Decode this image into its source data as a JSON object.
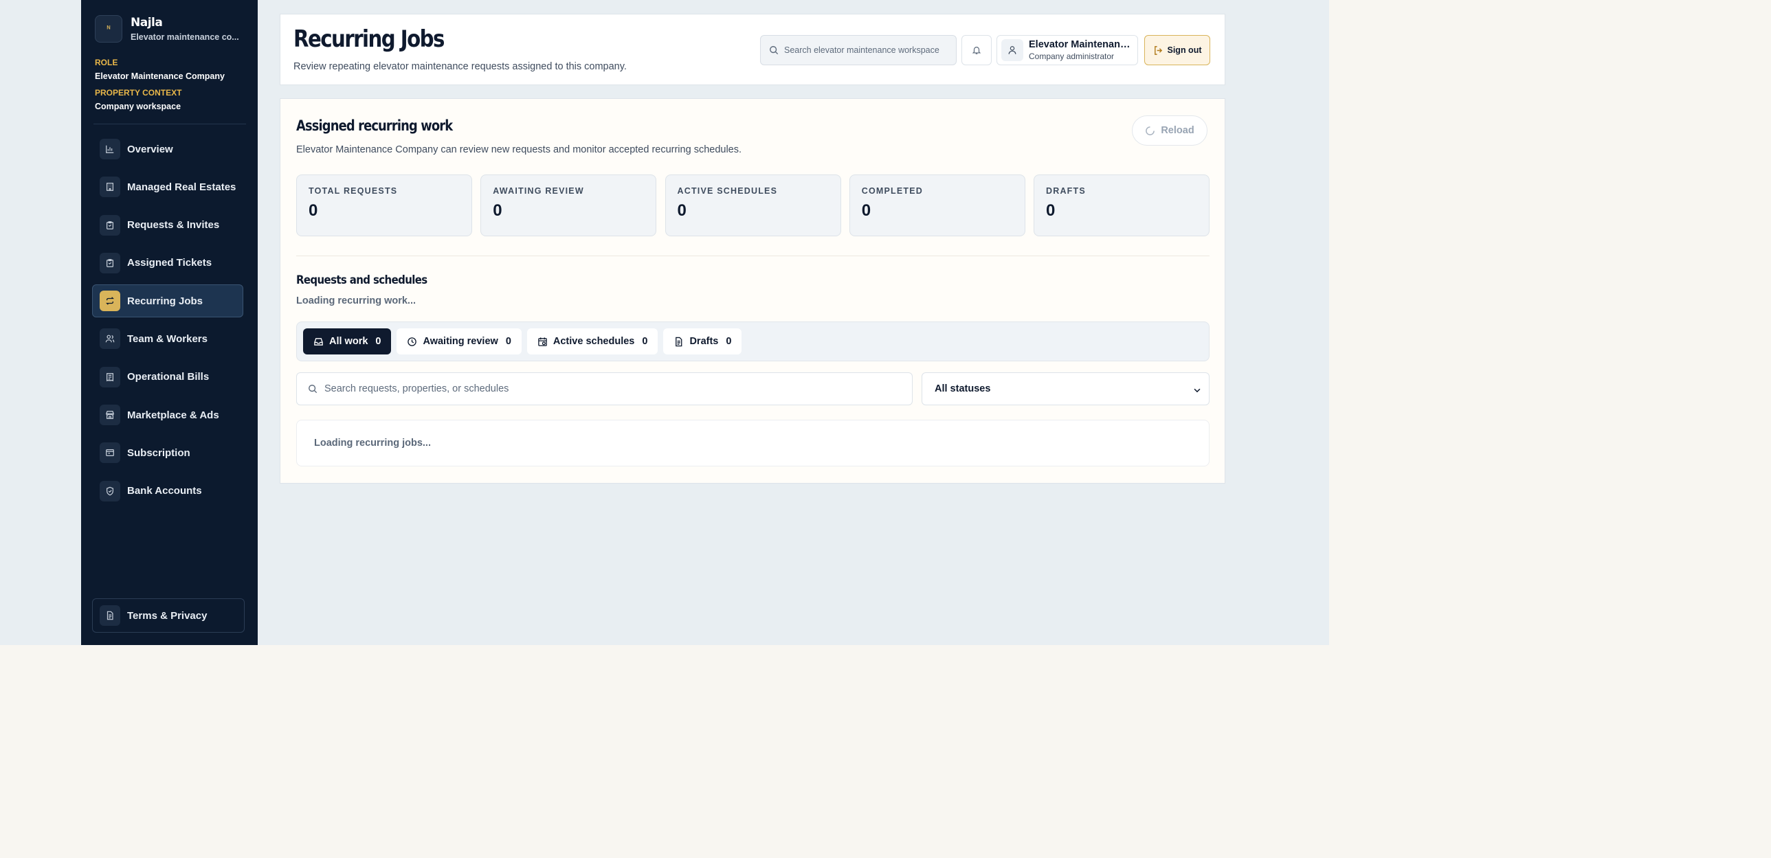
{
  "brand": {
    "name": "Najla",
    "subtitle": "Elevator maintenance co...",
    "logo_text": "ᴺ"
  },
  "context": {
    "role_label": "ROLE",
    "role_value": "Elevator Maintenance Company",
    "property_label": "PROPERTY CONTEXT",
    "property_value": "Company workspace"
  },
  "sidebar": {
    "items": [
      {
        "label": "Overview",
        "icon": "bar-chart-icon"
      },
      {
        "label": "Managed Real Estates",
        "icon": "building-icon"
      },
      {
        "label": "Requests & Invites",
        "icon": "clipboard-icon"
      },
      {
        "label": "Assigned Tickets",
        "icon": "clipboard-check-icon"
      },
      {
        "label": "Recurring Jobs",
        "icon": "repeat-icon",
        "active": true
      },
      {
        "label": "Team & Workers",
        "icon": "users-icon"
      },
      {
        "label": "Operational Bills",
        "icon": "receipt-icon"
      },
      {
        "label": "Marketplace & Ads",
        "icon": "store-icon"
      },
      {
        "label": "Subscription",
        "icon": "card-icon"
      },
      {
        "label": "Bank Accounts",
        "icon": "shield-icon"
      }
    ],
    "terms_label": "Terms & Privacy"
  },
  "header": {
    "title": "Recurring Jobs",
    "subtitle": "Review repeating elevator maintenance requests assigned to this company.",
    "search_placeholder": "Search elevator maintenance workspace",
    "user_name": "Elevator Maintenance Company",
    "user_role": "Company administrator",
    "signout_label": "Sign out"
  },
  "main": {
    "title": "Assigned recurring work",
    "subtitle": "Elevator Maintenance Company can review new requests and monitor accepted recurring schedules.",
    "reload_label": "Reload",
    "stats": [
      {
        "label": "TOTAL REQUESTS",
        "value": "0"
      },
      {
        "label": "AWAITING REVIEW",
        "value": "0"
      },
      {
        "label": "ACTIVE SCHEDULES",
        "value": "0"
      },
      {
        "label": "COMPLETED",
        "value": "0"
      },
      {
        "label": "DRAFTS",
        "value": "0"
      }
    ],
    "list_title": "Requests and schedules",
    "list_status": "Loading recurring work...",
    "tabs": [
      {
        "label": "All work",
        "count": "0",
        "icon": "inbox-icon"
      },
      {
        "label": "Awaiting review",
        "count": "0",
        "icon": "clock-icon"
      },
      {
        "label": "Active schedules",
        "count": "0",
        "icon": "calendar-icon"
      },
      {
        "label": "Drafts",
        "count": "0",
        "icon": "document-icon"
      }
    ],
    "filter_placeholder": "Search requests, properties, or schedules",
    "status_filter": "All statuses",
    "loading_text": "Loading recurring jobs..."
  },
  "colors": {
    "sidebar_bg": "#0c1a2e",
    "accent_gold": "#d9b45a",
    "app_bg": "#e8eef2",
    "active_tab": "#0f1a2e"
  }
}
